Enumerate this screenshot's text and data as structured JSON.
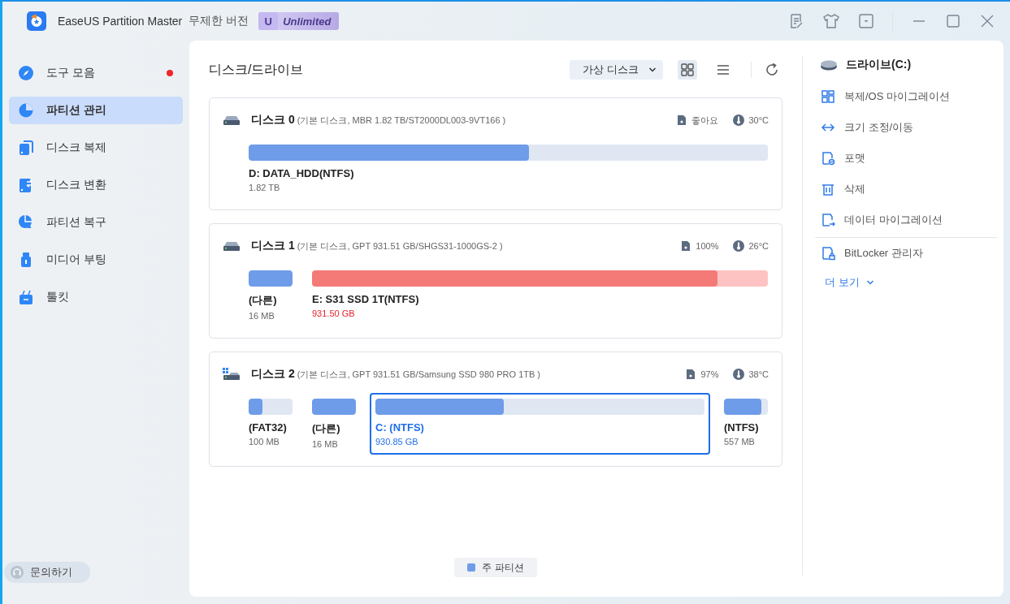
{
  "window": {
    "app_name": "EaseUS Partition Master",
    "edition": "무제한 버전",
    "badge_letter": "U",
    "badge": "Unlimited"
  },
  "sidebar": {
    "items": [
      {
        "label": "도구 모음",
        "kind": "tools",
        "selected": false,
        "notification": true
      },
      {
        "label": "파티션 관리",
        "kind": "partition",
        "selected": true,
        "notification": false
      },
      {
        "label": "디스크 복제",
        "kind": "clone",
        "selected": false,
        "notification": false
      },
      {
        "label": "디스크 변환",
        "kind": "convert",
        "selected": false,
        "notification": false
      },
      {
        "label": "파티션 복구",
        "kind": "recovery",
        "selected": false,
        "notification": false
      },
      {
        "label": "미디어 부팅",
        "kind": "media",
        "selected": false,
        "notification": false
      },
      {
        "label": "툴킷",
        "kind": "toolkit",
        "selected": false,
        "notification": false
      }
    ],
    "help_button": "문의하기"
  },
  "main": {
    "title": "디스크/드라이브",
    "view_dropdown": "가상 디스크",
    "view_buttons": [
      {
        "kind": "grid",
        "selected": true
      },
      {
        "kind": "list",
        "selected": false
      }
    ],
    "disks": [
      {
        "name": "디스크",
        "number": "0",
        "details": "(기본 디스크, MBR 1.82 TB/ST2000DL003-9VT166 )",
        "kind": "data",
        "health": "좋아요",
        "temperature": "30°C",
        "partitions": [
          {
            "label": "D: DATA_HDD(NTFS)",
            "size": "1.82 TB",
            "level": 0.54,
            "kind": "wide",
            "warning": false,
            "selected": false
          }
        ]
      },
      {
        "name": "디스크",
        "number": "1",
        "details": "(기본 디스크, GPT 931.51 GB/SHGS31-1000GS-2 )",
        "kind": "data",
        "health": "100%",
        "temperature": "26°C",
        "partitions": [
          {
            "label": "(다른)",
            "size": "16 MB",
            "level": 1,
            "kind": "compact",
            "warning": false,
            "selected": false
          },
          {
            "label": "E: S31 SSD 1T(NTFS)",
            "size": "931.50 GB",
            "level": 0.89,
            "kind": "wide",
            "warning": true,
            "selected": false
          }
        ]
      },
      {
        "name": "디스크",
        "number": "2",
        "details": "(기본 디스크, GPT 931.51 GB/Samsung SSD 980 PRO 1TB )",
        "kind": "system",
        "health": "97%",
        "temperature": "38°C",
        "partitions": [
          {
            "label": "(FAT32)",
            "size": "100 MB",
            "level": 0.31,
            "kind": "compact",
            "warning": false,
            "selected": false
          },
          {
            "label": "(다른)",
            "size": "16 MB",
            "level": 1,
            "kind": "compact",
            "warning": false,
            "selected": false
          },
          {
            "label": "C: (NTFS)",
            "size": "930.85 GB",
            "level": 0.39,
            "kind": "wide",
            "warning": false,
            "selected": true
          },
          {
            "label": "(NTFS)",
            "size": "557 MB",
            "level": 0.85,
            "kind": "compact",
            "warning": false,
            "selected": false
          }
        ]
      }
    ],
    "legend": [
      "주 파티션"
    ]
  },
  "right_panel": {
    "drive_title": "드라이브(C:)",
    "actions": [
      {
        "label": "복제/OS 마이그레이션",
        "kind": "clone"
      },
      {
        "label": "크기 조정/이동",
        "kind": "resize"
      },
      {
        "label": "포맷",
        "kind": "format"
      },
      {
        "label": "삭제",
        "kind": "delete"
      },
      {
        "label": "데이터 마이그레이션",
        "kind": "migrate"
      }
    ],
    "extra_actions": [
      {
        "label": "BitLocker 관리자",
        "kind": "lock"
      }
    ],
    "more": "더 보기"
  }
}
